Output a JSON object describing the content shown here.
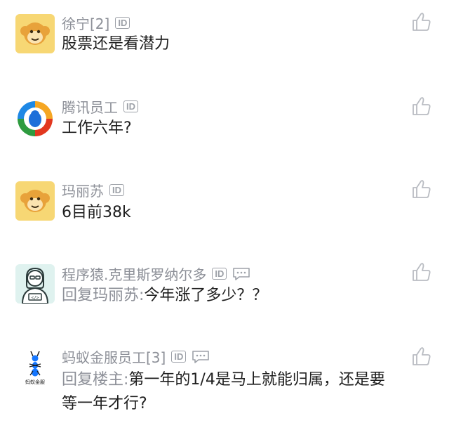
{
  "comments": [
    {
      "username": "徐宁[2]",
      "id_badge": "ID",
      "text": "股票还是看潜力",
      "avatar_icon": "monkey-avatar-icon"
    },
    {
      "username": "腾讯员工",
      "id_badge": "ID",
      "text": "工作六年?",
      "avatar_icon": "tencent-logo-avatar-icon"
    },
    {
      "username": "玛丽苏",
      "id_badge": "ID",
      "text": "6目前38k",
      "avatar_icon": "monkey-avatar-icon"
    },
    {
      "username": "程序猿.克里斯罗纳尔多",
      "id_badge": "ID",
      "reply_prefix": "回复玛丽苏:",
      "text": "今年涨了多少？？",
      "avatar_icon": "programmer-avatar-icon"
    },
    {
      "username": "蚂蚁金服员工[3]",
      "id_badge": "ID",
      "reply_prefix": "回复楼主:",
      "text": "第一年的1/4是马上就能归属，还是要等一年才行?",
      "avatar_icon": "ant-financial-avatar-icon",
      "avatar_label": "蚂蚁金服"
    }
  ],
  "icons": {
    "like": "thumbs-up-icon",
    "chat": "chat-bubble-icon"
  },
  "colors": {
    "username": "#8d9098",
    "text": "#1e1e1e",
    "monkey_bg": "#f7d774"
  }
}
